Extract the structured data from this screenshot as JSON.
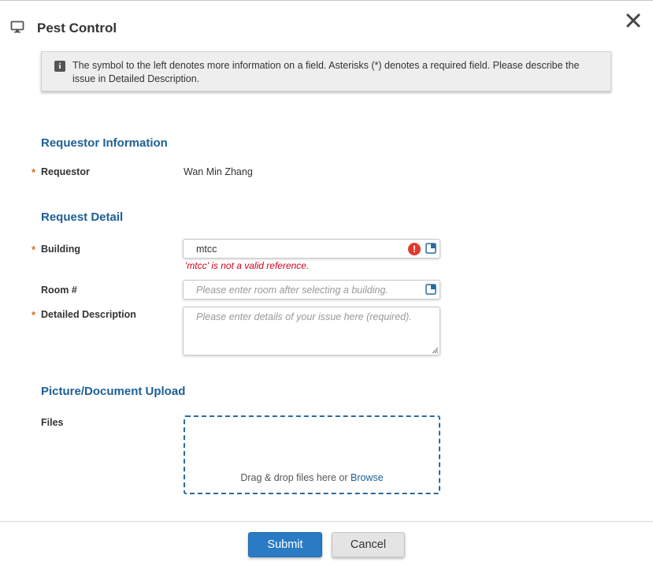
{
  "dialog": {
    "title": "Pest Control",
    "info_text": "The symbol to the left denotes more information on a field. Asterisks (*) denotes a required field. Please describe the issue in Detailed Description."
  },
  "requestor_section": {
    "heading": "Requestor Information",
    "requestor_label": "Requestor",
    "requestor_value": "Wan Min Zhang"
  },
  "request_detail": {
    "heading": "Request Detail",
    "building_label": "Building",
    "building_value": "mtcc",
    "building_error": "'mtcc' is not a valid reference.",
    "room_label": "Room #",
    "room_placeholder": "Please enter room after selecting a building.",
    "description_label": "Detailed Description",
    "description_placeholder": "Please enter details of your issue here (required)."
  },
  "upload": {
    "heading": "Picture/Document Upload",
    "files_label": "Files",
    "drop_text": "Drag & drop files here or",
    "browse_label": "Browse"
  },
  "required_marker": "*",
  "footer": {
    "submit_label": "Submit",
    "cancel_label": "Cancel"
  },
  "colors": {
    "accent": "#1d5f97",
    "required": "#e06a1c",
    "error": "#d0021b",
    "submit": "#2a7bc4"
  },
  "icons": [
    "monitor-icon",
    "close-icon",
    "info-icon",
    "error-icon",
    "lookup-icon",
    "resize-grip-icon"
  ]
}
